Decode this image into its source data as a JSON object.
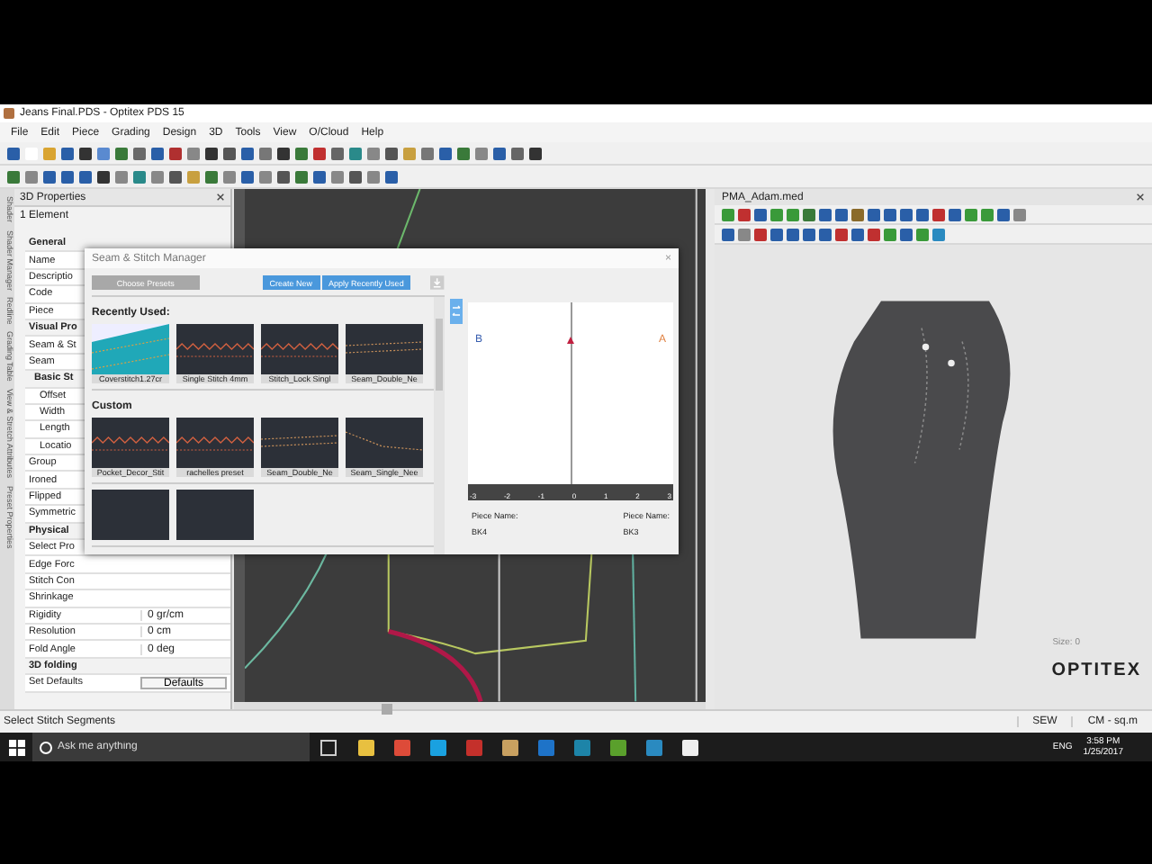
{
  "window": {
    "title": "Jeans Final.PDS - Optitex PDS 15"
  },
  "menu": [
    "File",
    "Edit",
    "Piece",
    "Grading",
    "Design",
    "3D",
    "Tools",
    "View",
    "O/Cloud",
    "Help"
  ],
  "side_tabs": [
    "Shader",
    "Shader Manager",
    "Redline",
    "Grading Table",
    "View & Stretch Attributes",
    "Preset Properties"
  ],
  "properties_panel": {
    "title": "3D Properties",
    "element_label": "1 Element",
    "rows": [
      {
        "kind": "category",
        "label": "General"
      },
      {
        "kind": "property",
        "label": "Name"
      },
      {
        "kind": "property",
        "label": "Descriptio"
      },
      {
        "kind": "property",
        "label": "Code"
      },
      {
        "kind": "property",
        "label": "Piece"
      },
      {
        "kind": "category",
        "label": "Visual Pro"
      },
      {
        "kind": "property",
        "label": "Seam & St"
      },
      {
        "kind": "property",
        "label": "Seam",
        "children": [
          {
            "kind": "category",
            "label": "Basic St",
            "children": [
              {
                "kind": "property",
                "label": "Offset"
              },
              {
                "kind": "property",
                "label": "Width"
              },
              {
                "kind": "property",
                "label": "Length"
              },
              {
                "kind": "property",
                "label": "Locatio"
              }
            ]
          }
        ]
      },
      {
        "kind": "property",
        "label": "Group"
      },
      {
        "kind": "property",
        "label": "Ironed"
      },
      {
        "kind": "property",
        "label": "Flipped"
      },
      {
        "kind": "property",
        "label": "Symmetric"
      },
      {
        "kind": "category",
        "label": "Physical"
      },
      {
        "kind": "property",
        "label": "Select Pro"
      },
      {
        "kind": "property",
        "label": "Edge Forc"
      },
      {
        "kind": "property",
        "label": "Stitch Con"
      },
      {
        "kind": "property",
        "label": "Shrinkage"
      },
      {
        "kind": "property",
        "label": "Rigidity",
        "value": "0 gr/cm"
      },
      {
        "kind": "property",
        "label": "Resolution",
        "value": "0 cm"
      },
      {
        "kind": "property",
        "label": "Fold Angle",
        "value": "0 deg"
      },
      {
        "kind": "category",
        "label": "3D folding"
      },
      {
        "kind": "button",
        "label": "Set Defaults",
        "value": "Defaults"
      }
    ]
  },
  "stitch_manager": {
    "title": "Seam & Stitch Manager",
    "close": "×",
    "buttons": [
      {
        "label": "Choose Presets",
        "kind": "secondary"
      },
      {
        "label": "Create New",
        "kind": "primary"
      },
      {
        "label": "Apply Recently Used",
        "kind": "primary"
      }
    ],
    "sections": [
      {
        "title": "Recently Used:",
        "items": [
          {
            "label": "Coverstitch1.27cr",
            "kind": "teal"
          },
          {
            "label": "Single Stitch 4mm",
            "kind": "zigzag"
          },
          {
            "label": "Stitch_Lock Singl",
            "kind": "zigzag"
          },
          {
            "label": "Seam_Double_Ne",
            "kind": "double"
          }
        ]
      },
      {
        "title": "Custom",
        "items": [
          {
            "label": "Pocket_Decor_Stit",
            "kind": "zigzag"
          },
          {
            "label": "rachelles preset",
            "kind": "zigzag"
          },
          {
            "label": "Seam_Double_Ne",
            "kind": "double"
          },
          {
            "label": "Seam_Single_Nee",
            "kind": "single"
          }
        ]
      },
      {
        "items": [
          {
            "kind": "plain"
          },
          {
            "kind": "plain"
          }
        ]
      }
    ],
    "preview": {
      "left_marker": "B",
      "right_marker": "A",
      "ruler_ticks": [
        "-3",
        "-2",
        "-1",
        "0",
        "1",
        "2",
        "3"
      ],
      "pieces": [
        {
          "label": "Piece Name:",
          "value": "BK4"
        },
        {
          "label": "Piece Name:",
          "value": "BK3"
        }
      ]
    }
  },
  "view3d": {
    "title": "PMA_Adam.med",
    "size_label": "Size: 0",
    "logo": "OPTITEX"
  },
  "status_bar": {
    "message": "Select Stitch Segments",
    "mode": "SEW",
    "units": "CM - sq.m"
  },
  "taskbar": {
    "search_placeholder": "Ask me anything",
    "time": "3:58 PM",
    "date": "1/25/2017",
    "language": "ENG"
  }
}
